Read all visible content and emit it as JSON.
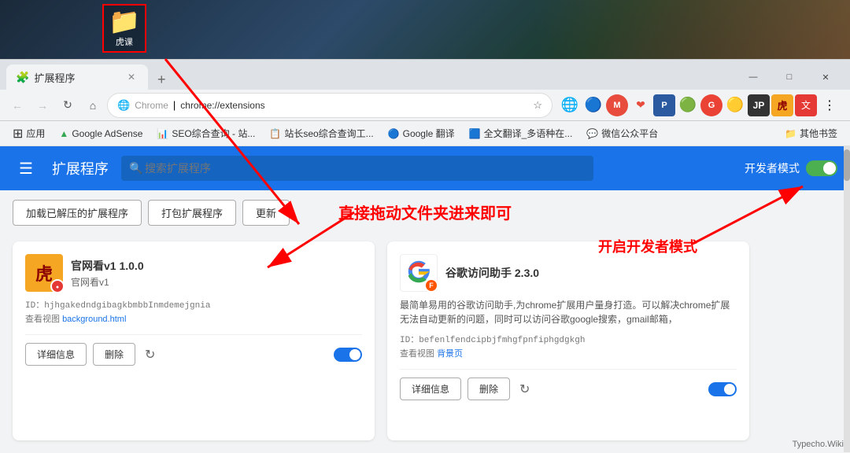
{
  "topArea": {
    "folderLabel": "虎课"
  },
  "browser": {
    "tab": {
      "title": "扩展程序",
      "icon": "🧩"
    },
    "windowControls": {
      "minimize": "—",
      "maximize": "□",
      "close": "✕"
    },
    "addressBar": {
      "chromeLabel": "Chrome",
      "separator": "|",
      "url": "chrome://extensions",
      "favicon": "🌐"
    },
    "bookmarks": [
      {
        "label": "应用",
        "icon": "⊞"
      },
      {
        "label": "Google AdSense"
      },
      {
        "label": "SEO综合查询 - 站..."
      },
      {
        "label": "站长seo综合查询工..."
      },
      {
        "label": "Google 翻译"
      },
      {
        "label": "全文翻译_多语种在..."
      },
      {
        "label": "微信公众平台"
      },
      {
        "label": "其他书签"
      }
    ]
  },
  "extensionsPage": {
    "nav": {
      "hamburger": "☰",
      "title": "扩展程序",
      "searchPlaceholder": "搜索扩展程序",
      "devModeLabel": "开发者模式"
    },
    "actions": {
      "load": "加载已解压的扩展程序",
      "pack": "打包扩展程序",
      "update": "更新"
    },
    "annotations": {
      "dragText": "直接拖动文件夹进来即可",
      "devModeText": "开启开发者模式"
    },
    "cards": [
      {
        "name": "官网看v1 1.0.0",
        "subtitle": "官网看v1",
        "logoText": "虎",
        "logoColor": "#f5a623",
        "logoTextColor": "#8b0000",
        "hasBadge": true,
        "id": "ID：hjhgakedndgibagkbmbbInmdemejgnia",
        "viewLabel": "查看视图",
        "viewLink": "background.html",
        "detailsBtn": "详细信息",
        "removeBtn": "删除",
        "enabled": true
      },
      {
        "name": "谷歌访问助手 2.3.0",
        "subtitle": "",
        "desc": "最简单易用的谷歌访问助手,为chrome扩展用户量身打造。可以解决chrome扩展无法自动更新的问题，同时可以访问谷歌google搜索，gmail邮箱，",
        "logoType": "google",
        "hasBadge": true,
        "id": "ID：befenlfendcipbjfmhgfpnfiphgdgkgh",
        "viewLabel": "查看视图",
        "viewLink": "背景页",
        "detailsBtn": "详细信息",
        "removeBtn": "删除",
        "enabled": true
      }
    ]
  },
  "watermark": "Typecho.Wiki"
}
